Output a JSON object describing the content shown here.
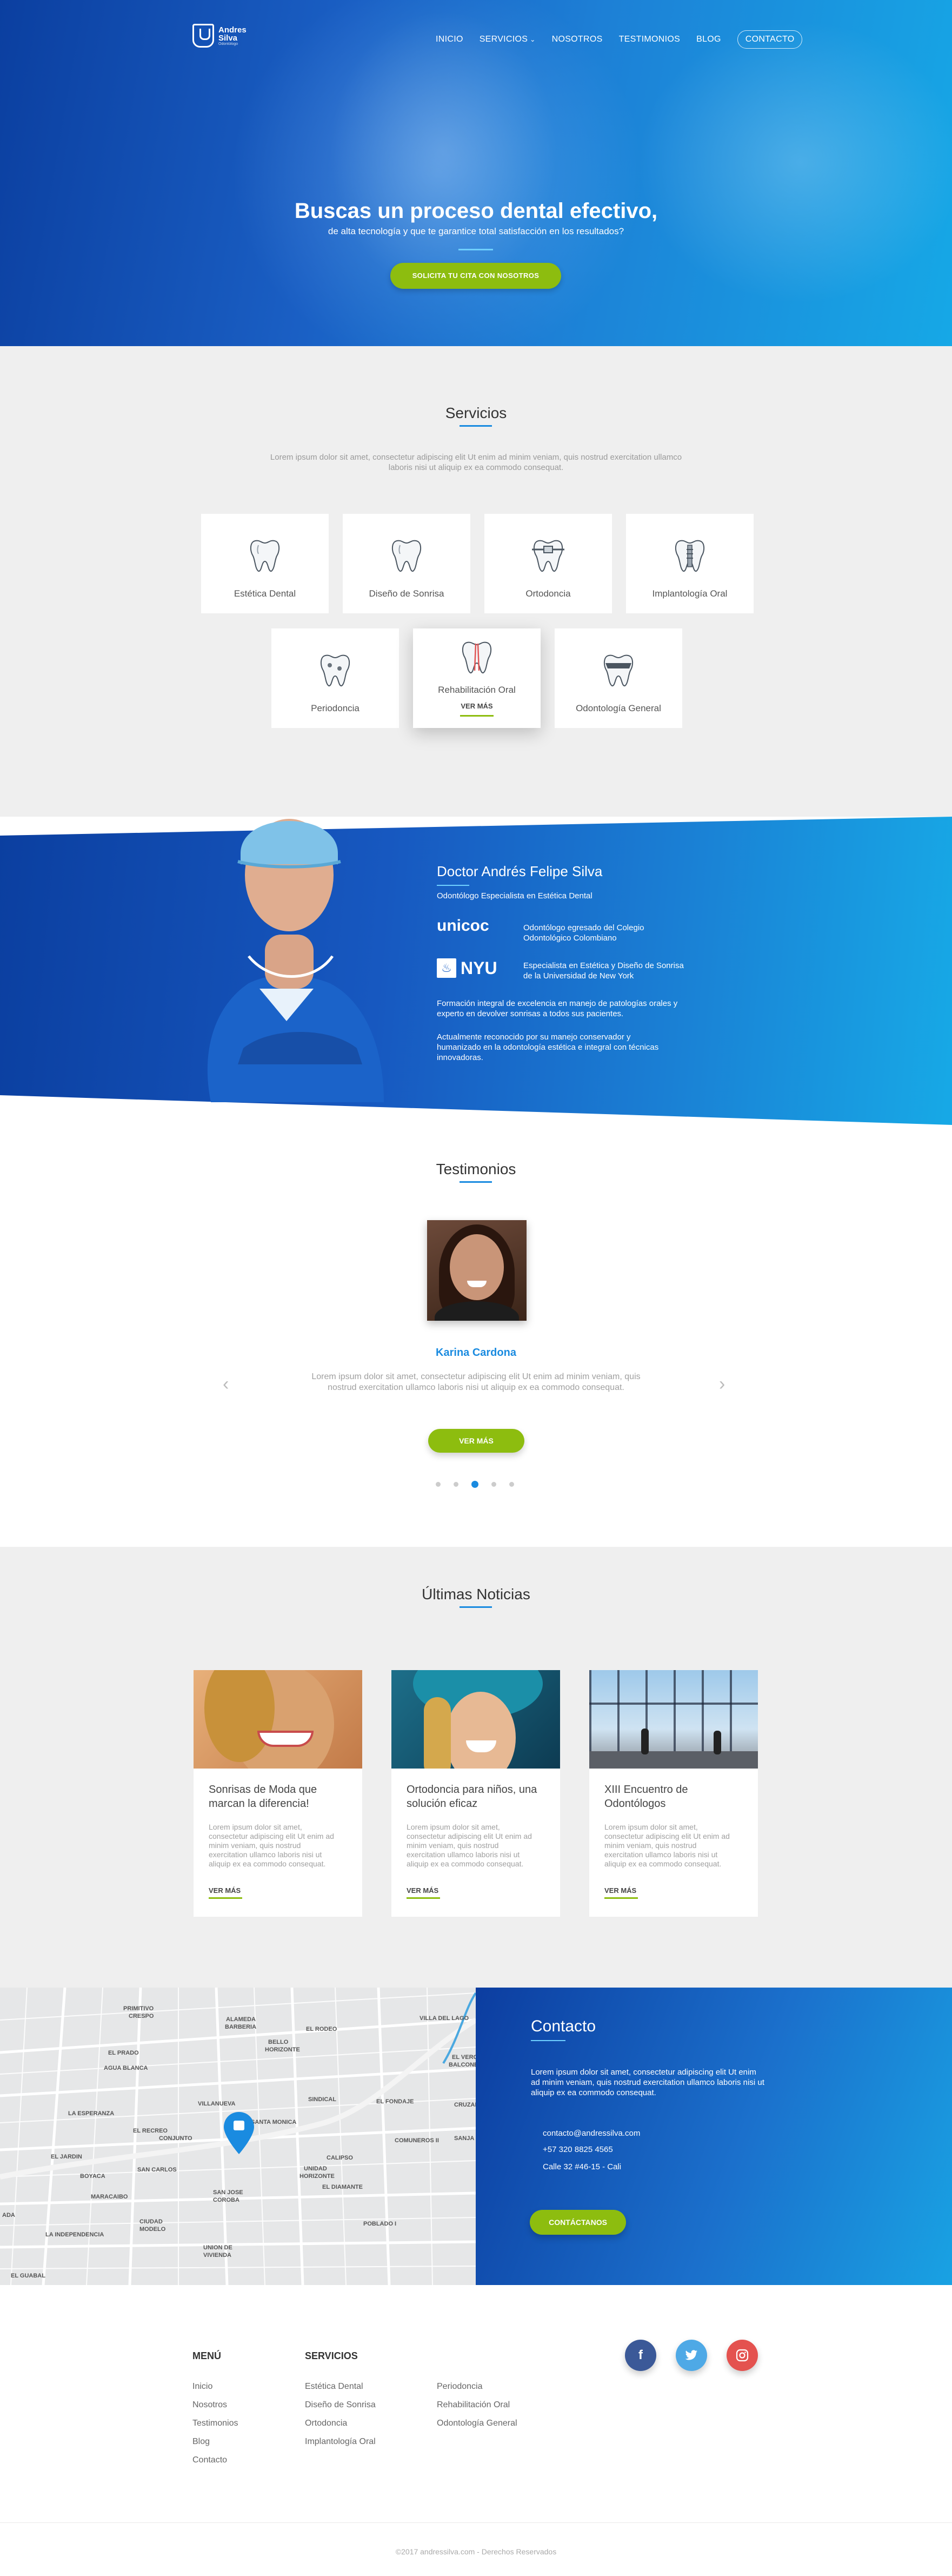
{
  "header": {
    "logo_line1": "Andres",
    "logo_line2": "Silva",
    "logo_sub": "Odontólogo",
    "nav": [
      {
        "label": "INICIO"
      },
      {
        "label": "SERVICIOS"
      },
      {
        "label": "NOSOTROS"
      },
      {
        "label": "TESTIMONIOS"
      },
      {
        "label": "BLOG"
      },
      {
        "label": "CONTACTO"
      }
    ]
  },
  "hero": {
    "title": "Buscas un proceso dental efectivo,",
    "subtitle": "de alta tecnología y que te garantice total satisfacción en los resultados?",
    "cta": "SOLICITA TU CITA CON NOSOTROS"
  },
  "services": {
    "title": "Servicios",
    "text_line1": "Lorem ipsum dolor sit amet, consectetur adipiscing elit Ut enim ad minim veniam, quis nostrud exercitation ullamco",
    "text_line2": "laboris nisi ut aliquip ex ea commodo consequat.",
    "items": [
      {
        "label": "Estética Dental",
        "icon": "tooth-icon"
      },
      {
        "label": "Diseño de Sonrisa",
        "icon": "tooth-icon"
      },
      {
        "label": "Ortodoncia",
        "icon": "braces-tooth-icon"
      },
      {
        "label": "Implantología Oral",
        "icon": "implant-tooth-icon"
      },
      {
        "label": "Periodoncia",
        "icon": "gum-tooth-icon"
      },
      {
        "label": "Rehabilitación Oral",
        "icon": "root-canal-tooth-icon"
      },
      {
        "label": "Odontología General",
        "icon": "crown-tooth-icon"
      }
    ],
    "ver_mas": "VER MÁS"
  },
  "doctor": {
    "name": "Doctor Andrés Felipe Silva",
    "subtitle": "Odontólogo Especialista en Estética Dental",
    "unicoc_logo": "unicoc",
    "unicoc_line1": "Odontólogo egresado del Colegio",
    "unicoc_line2": "Odontológico Colombiano",
    "nyu_logo": "NYU",
    "nyu_line1": "Especialista en Estética y Diseño de Sonrisa",
    "nyu_line2": "de la Universidad de New York",
    "p1_line1": "Formación integral de excelencia en manejo de patologías orales y",
    "p1_line2": "experto en devolver sonrisas a todos sus pacientes.",
    "p2_line1": "Actualmente reconocido por su manejo conservador y",
    "p2_line2": "humanizado en la odontología estética e integral con técnicas",
    "p2_line3": "innovadoras."
  },
  "testimonials": {
    "title": "Testimonios",
    "name": "Karina Cardona",
    "text_line1": "Lorem ipsum dolor sit amet, consectetur adipiscing elit Ut enim ad minim veniam, quis",
    "text_line2": "nostrud exercitation ullamco laboris nisi ut aliquip ex ea commodo consequat.",
    "ver_mas": "VER MÁS",
    "prev": "‹",
    "next": "›",
    "dots": 5,
    "active_dot": 3
  },
  "news": {
    "title": "Últimas Noticias",
    "items": [
      {
        "title_line1": "Sonrisas de Moda que",
        "title_line2": "marcan la diferencia!",
        "text": [
          "Lorem ipsum dolor sit amet,",
          "consectetur adipiscing elit Ut enim ad",
          "minim veniam, quis nostrud",
          "exercitation ullamco laboris nisi ut",
          "aliquip ex ea commodo consequat."
        ],
        "ver": "VER MÁS"
      },
      {
        "title_line1": "Ortodoncia para niños, una",
        "title_line2": "solución eficaz",
        "text": [
          "Lorem ipsum dolor sit amet,",
          "consectetur adipiscing elit Ut enim ad",
          "minim veniam, quis nostrud",
          "exercitation ullamco laboris nisi ut",
          "aliquip ex ea commodo consequat."
        ],
        "ver": "VER MÁS"
      },
      {
        "title_line1": "XIII Encuentro de",
        "title_line2": "Odontólogos",
        "text": [
          "Lorem ipsum dolor sit amet,",
          "consectetur adipiscing elit Ut enim ad",
          "minim veniam, quis nostrud",
          "exercitation ullamco laboris nisi ut",
          "aliquip ex ea commodo consequat."
        ],
        "ver": "VER MÁS"
      }
    ]
  },
  "map": {
    "labels": [
      "PRIMITIVO",
      "CRESPO",
      "ALAMEDA",
      "BARBERIA",
      "EL RODEO",
      "VILLA DEL LAGO",
      "EL PRADO",
      "BELLO",
      "HORIZONTE",
      "AGUA BLANCA",
      "SINDICAL",
      "EL VERGEL",
      "BALCONES",
      "VILLANUEVA",
      "EL FONDAJE",
      "LA ESPERANZA",
      "EL RECREO",
      "SANTA MONICA",
      "CRUZADA",
      "COMUNEROS II",
      "SANJA",
      "EL JARDIN",
      "CONJUNTO",
      "CALIPSO",
      "BOYACA",
      "SAN CARLOS",
      "UNIDAD",
      "HORIZONTE",
      "EL DIAMANTE",
      "MARACAIBO",
      "SAN JOSE",
      "COROBA",
      "POBLADO I",
      "LA INDEPENDENCIA",
      "CIUDAD",
      "MODELO",
      "UNION DE",
      "VIVIENDA",
      "EL GUABAL",
      "ADA"
    ]
  },
  "contact": {
    "title": "Contacto",
    "text_line1": "Lorem ipsum dolor sit amet, consectetur adipiscing elit Ut enim",
    "text_line2": "ad minim veniam, quis nostrud exercitation ullamco laboris nisi ut",
    "text_line3": "aliquip ex ea commodo consequat.",
    "email": "contacto@andressilva.com",
    "phone": "+57 320 8825 4565",
    "address": "Calle 32 #46-15 - Cali",
    "cta": "CONTÁCTANOS"
  },
  "footer": {
    "menu_title": "MENÚ",
    "menu": [
      "Inicio",
      "Nosotros",
      "Testimonios",
      "Blog",
      "Contacto"
    ],
    "services_title": "SERVICIOS",
    "services_col1": [
      "Estética Dental",
      "Diseño de Sonrisa",
      "Ortodoncia",
      "Implantología Oral"
    ],
    "services_col2": [
      "Periodoncia",
      "Rehabilitación Oral",
      "Odontología General"
    ],
    "social": [
      {
        "icon": "facebook-icon",
        "glyph": "f",
        "color": "#3b5998"
      },
      {
        "icon": "twitter-icon",
        "glyph": "t",
        "color": "#4ea9e6"
      },
      {
        "icon": "instagram-icon",
        "glyph": "◎",
        "color": "#e4524f"
      }
    ],
    "copyright": "©2017 andressilva.com - Derechos Reservados"
  },
  "colors": {
    "accent": "#1a8be0",
    "cta_green": "#8dbd0f",
    "hero_dark": "#0b3fa0"
  }
}
